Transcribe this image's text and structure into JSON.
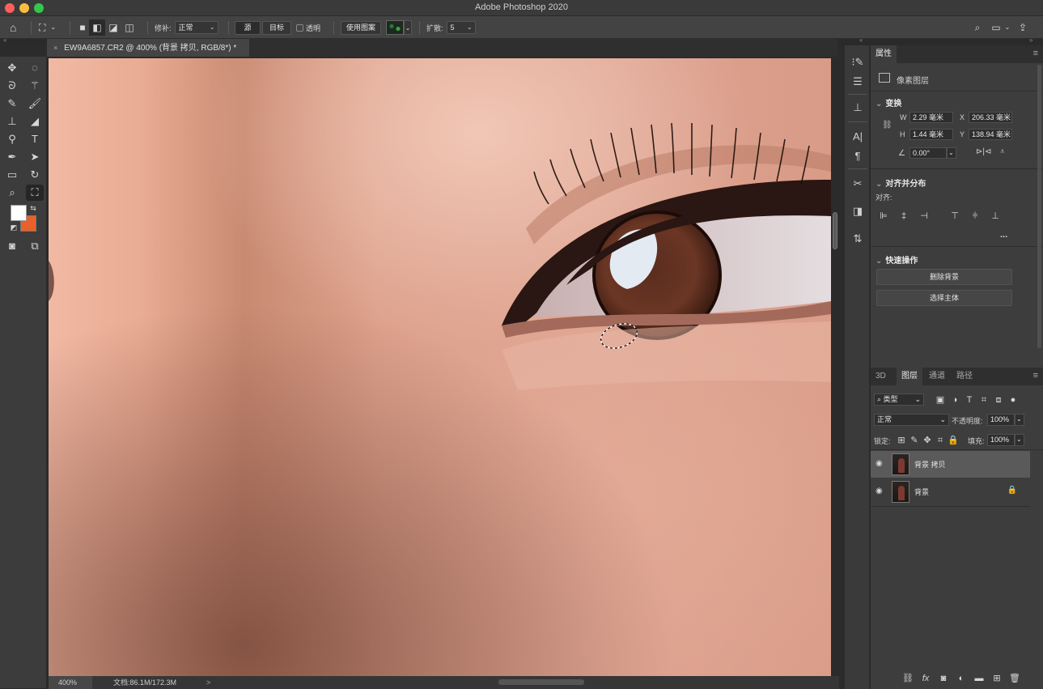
{
  "window": {
    "title": "Adobe Photoshop 2020"
  },
  "options_bar": {
    "patch_label": "修补:",
    "patch_mode": "正常",
    "source_label": "源",
    "target_label": "目标",
    "transparent_label": "透明",
    "use_pattern_label": "使用图案",
    "diffusion_label": "扩散:",
    "diffusion_value": "5"
  },
  "document": {
    "tab_title": "EW9A6857.CR2 @ 400% (背景 拷贝, RGB/8*) *",
    "zoom": "400%",
    "doc_info": "文档:86.1M/172.3M",
    "status_arrow": ">"
  },
  "colors": {
    "foreground": "#ffffff",
    "background": "#e8612a",
    "accent_swatch": "#e8612a"
  },
  "properties_panel": {
    "tab_label": "属性",
    "layer_type": "像素图层",
    "transform": {
      "title": "变换",
      "w_label": "W",
      "w_value": "2.29 毫米",
      "h_label": "H",
      "h_value": "1.44 毫米",
      "x_label": "X",
      "x_value": "206.33 毫米",
      "y_label": "Y",
      "y_value": "138.94 毫米",
      "angle_value": "0.00°"
    },
    "align": {
      "title": "对齐并分布",
      "align_label": "对齐:",
      "more": "..."
    },
    "quick_actions": {
      "title": "快速操作",
      "remove_bg": "删除背景",
      "select_subject": "选择主体"
    }
  },
  "layers_panel": {
    "tabs": [
      "3D",
      "图层",
      "通道",
      "路径"
    ],
    "filter_label": "类型",
    "blend_mode": "正常",
    "opacity_label": "不透明度:",
    "opacity_value": "100%",
    "lock_label": "锁定:",
    "fill_label": "填充:",
    "fill_value": "100%",
    "layers": [
      {
        "name": "背景 拷贝",
        "selected": true,
        "locked": false
      },
      {
        "name": "背景",
        "selected": false,
        "locked": true
      }
    ]
  }
}
